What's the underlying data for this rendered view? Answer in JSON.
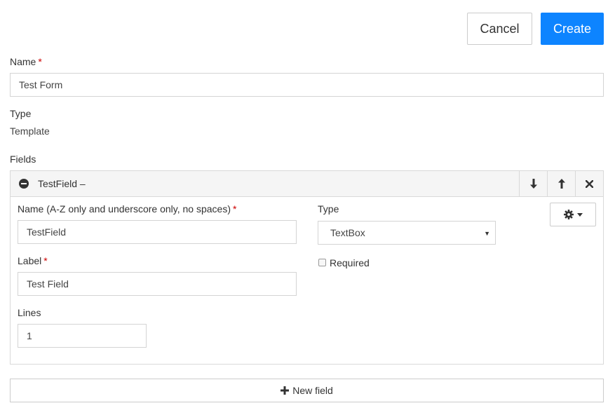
{
  "toolbar": {
    "cancel_label": "Cancel",
    "create_label": "Create"
  },
  "form": {
    "name_label": "Name",
    "name_value": "Test Form",
    "type_label": "Type",
    "type_value": "Template",
    "fields_label": "Fields",
    "required_marker": "*"
  },
  "field": {
    "header_title": "TestField –",
    "name_label": "Name (A-Z only and underscore only, no spaces)",
    "name_value": "TestField",
    "label_label": "Label",
    "label_value": "Test Field",
    "lines_label": "Lines",
    "lines_value": "1",
    "type_label": "Type",
    "type_selected": "TextBox",
    "required_label": "Required",
    "required_checked": false
  },
  "actions": {
    "new_field_label": "New field"
  },
  "icons": {
    "collapse": "minus-circle-icon",
    "move_down": "arrow-down-icon",
    "move_up": "arrow-up-icon",
    "remove": "close-icon",
    "settings": "gear-icon",
    "add": "plus-icon"
  },
  "colors": {
    "primary": "#0d84ff",
    "required": "#cc0000",
    "border": "#d4d4d4",
    "header_bg": "#f5f5f5"
  }
}
